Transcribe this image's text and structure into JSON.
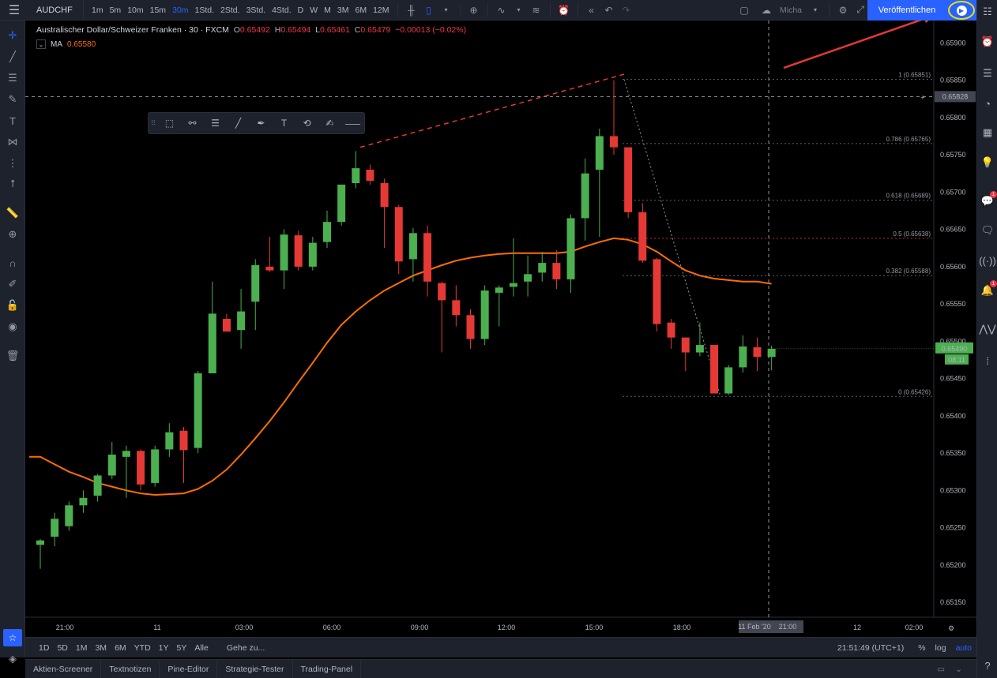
{
  "toolbar": {
    "symbol": "AUDCHF",
    "intervals": [
      "1m",
      "5m",
      "10m",
      "15m",
      "30m",
      "1Std.",
      "2Std.",
      "3Std.",
      "4Std.",
      "D",
      "W",
      "M",
      "3M",
      "6M",
      "12M"
    ],
    "active_interval": "30m",
    "layout_name": "Micha",
    "publish_label": "Veröffentlichen"
  },
  "legend": {
    "title": "Australischer Dollar/Schweizer Franken · 30 · FXCM",
    "o_key": "O",
    "o": "0.65492",
    "h_key": "H",
    "h": "0.65494",
    "l_key": "L",
    "l": "0.65461",
    "c_key": "C",
    "c": "0.65479",
    "change": "−0.00013 (−0.02%)",
    "ma_label": "MA",
    "ma_value": "0.65580"
  },
  "price_axis": {
    "ticks": [
      "0.65900",
      "0.65850",
      "0.65800",
      "0.65750",
      "0.65700",
      "0.65650",
      "0.65600",
      "0.65550",
      "0.65500",
      "0.65450",
      "0.65400",
      "0.65350",
      "0.65300",
      "0.65250",
      "0.65200",
      "0.65150"
    ],
    "crosshair_price": "0.65828",
    "last_price": "0.65490",
    "countdown": "08:11"
  },
  "time_axis": {
    "ticks": [
      "21:00",
      "11",
      "03:00",
      "06:00",
      "09:00",
      "12:00",
      "15:00",
      "18:00",
      "12",
      "02:00"
    ],
    "crosshair_time": "11 Feb '20",
    "crosshair_hour": "21:00"
  },
  "fib_levels": [
    {
      "label": "1 (0.65851)",
      "price": 0.65851
    },
    {
      "label": "0.786 (0.65765)",
      "price": 0.65765
    },
    {
      "label": "0.618 (0.65689)",
      "price": 0.65689
    },
    {
      "label": "0.5 (0.65638)",
      "price": 0.65638
    },
    {
      "label": "0.382 (0.65588)",
      "price": 0.65588
    },
    {
      "label": "0 (0.65426)",
      "price": 0.65426
    }
  ],
  "date_range": {
    "ranges": [
      "1D",
      "5D",
      "1M",
      "3M",
      "6M",
      "YTD",
      "1Y",
      "5Y",
      "Alle"
    ],
    "goto_label": "Gehe zu...",
    "clock": "21:51:49 (UTC+1)",
    "percent": "%",
    "log": "log",
    "auto": "auto"
  },
  "panels": [
    "Aktien-Screener",
    "Textnotizen",
    "Pine-Editor",
    "Strategie-Tester",
    "Trading-Panel"
  ],
  "colors": {
    "up": "#4caf50",
    "down": "#e53935",
    "ma": "#ff6d00",
    "accent": "#2962ff",
    "highlight_ring": "#e5e011",
    "arrow": "#e53935"
  },
  "chart_data": {
    "type": "candlestick",
    "title": "Australischer Dollar/Schweizer Franken · 30 · FXCM",
    "interval": "30m",
    "ylim": [
      0.6513,
      0.6593
    ],
    "candles": [
      {
        "o": 0.65227,
        "h": 0.65235,
        "l": 0.65195,
        "c": 0.65233
      },
      {
        "o": 0.65238,
        "h": 0.6527,
        "l": 0.65225,
        "c": 0.65262
      },
      {
        "o": 0.65252,
        "h": 0.65285,
        "l": 0.65246,
        "c": 0.6528
      },
      {
        "o": 0.6528,
        "h": 0.653,
        "l": 0.6527,
        "c": 0.6529
      },
      {
        "o": 0.65293,
        "h": 0.65322,
        "l": 0.65285,
        "c": 0.6532
      },
      {
        "o": 0.6532,
        "h": 0.65365,
        "l": 0.65315,
        "c": 0.65348
      },
      {
        "o": 0.65345,
        "h": 0.6536,
        "l": 0.6529,
        "c": 0.65353
      },
      {
        "o": 0.65353,
        "h": 0.65355,
        "l": 0.653,
        "c": 0.65308
      },
      {
        "o": 0.6531,
        "h": 0.6536,
        "l": 0.65305,
        "c": 0.65355
      },
      {
        "o": 0.65355,
        "h": 0.6539,
        "l": 0.65345,
        "c": 0.65378
      },
      {
        "o": 0.6538,
        "h": 0.65385,
        "l": 0.6531,
        "c": 0.65354
      },
      {
        "o": 0.65357,
        "h": 0.6546,
        "l": 0.6535,
        "c": 0.65457
      },
      {
        "o": 0.65457,
        "h": 0.6558,
        "l": 0.6551,
        "c": 0.65537
      },
      {
        "o": 0.6553,
        "h": 0.65537,
        "l": 0.65513,
        "c": 0.65513
      },
      {
        "o": 0.65515,
        "h": 0.6557,
        "l": 0.6549,
        "c": 0.6554
      },
      {
        "o": 0.65553,
        "h": 0.6561,
        "l": 0.65515,
        "c": 0.65602
      },
      {
        "o": 0.656,
        "h": 0.6564,
        "l": 0.65593,
        "c": 0.65595
      },
      {
        "o": 0.65595,
        "h": 0.6565,
        "l": 0.6557,
        "c": 0.65643
      },
      {
        "o": 0.65642,
        "h": 0.65648,
        "l": 0.65595,
        "c": 0.656
      },
      {
        "o": 0.656,
        "h": 0.6564,
        "l": 0.65595,
        "c": 0.65632
      },
      {
        "o": 0.65633,
        "h": 0.65675,
        "l": 0.65625,
        "c": 0.6566
      },
      {
        "o": 0.6566,
        "h": 0.6571,
        "l": 0.65655,
        "c": 0.6571
      },
      {
        "o": 0.65712,
        "h": 0.65755,
        "l": 0.65705,
        "c": 0.65732
      },
      {
        "o": 0.6573,
        "h": 0.65737,
        "l": 0.6571,
        "c": 0.65715
      },
      {
        "o": 0.65712,
        "h": 0.65718,
        "l": 0.65625,
        "c": 0.6568
      },
      {
        "o": 0.6568,
        "h": 0.65683,
        "l": 0.6559,
        "c": 0.65607
      },
      {
        "o": 0.6561,
        "h": 0.65652,
        "l": 0.6558,
        "c": 0.65645
      },
      {
        "o": 0.65645,
        "h": 0.65655,
        "l": 0.6556,
        "c": 0.6558
      },
      {
        "o": 0.65578,
        "h": 0.6558,
        "l": 0.65485,
        "c": 0.65555
      },
      {
        "o": 0.65555,
        "h": 0.65575,
        "l": 0.6552,
        "c": 0.65535
      },
      {
        "o": 0.65535,
        "h": 0.65543,
        "l": 0.6549,
        "c": 0.65503
      },
      {
        "o": 0.65503,
        "h": 0.65575,
        "l": 0.65495,
        "c": 0.65568
      },
      {
        "o": 0.65565,
        "h": 0.65575,
        "l": 0.6552,
        "c": 0.65572
      },
      {
        "o": 0.65573,
        "h": 0.65638,
        "l": 0.6556,
        "c": 0.65578
      },
      {
        "o": 0.6558,
        "h": 0.65615,
        "l": 0.6556,
        "c": 0.6559
      },
      {
        "o": 0.65592,
        "h": 0.6562,
        "l": 0.6558,
        "c": 0.65605
      },
      {
        "o": 0.65605,
        "h": 0.65622,
        "l": 0.6557,
        "c": 0.65583
      },
      {
        "o": 0.65583,
        "h": 0.6567,
        "l": 0.65565,
        "c": 0.65665
      },
      {
        "o": 0.65665,
        "h": 0.65745,
        "l": 0.65635,
        "c": 0.65725
      },
      {
        "o": 0.6573,
        "h": 0.65785,
        "l": 0.6564,
        "c": 0.65775
      },
      {
        "o": 0.65775,
        "h": 0.6585,
        "l": 0.6575,
        "c": 0.6576
      },
      {
        "o": 0.6576,
        "h": 0.6576,
        "l": 0.65665,
        "c": 0.65673
      },
      {
        "o": 0.65673,
        "h": 0.65685,
        "l": 0.65605,
        "c": 0.65608
      },
      {
        "o": 0.6561,
        "h": 0.65612,
        "l": 0.65513,
        "c": 0.65523
      },
      {
        "o": 0.65525,
        "h": 0.6553,
        "l": 0.6549,
        "c": 0.65505
      },
      {
        "o": 0.65505,
        "h": 0.65505,
        "l": 0.6546,
        "c": 0.65485
      },
      {
        "o": 0.65485,
        "h": 0.65525,
        "l": 0.6548,
        "c": 0.65495
      },
      {
        "o": 0.65495,
        "h": 0.65495,
        "l": 0.6543,
        "c": 0.6543
      },
      {
        "o": 0.6543,
        "h": 0.65468,
        "l": 0.65428,
        "c": 0.65465
      },
      {
        "o": 0.65465,
        "h": 0.65508,
        "l": 0.65458,
        "c": 0.65493
      },
      {
        "o": 0.65492,
        "h": 0.65505,
        "l": 0.6546,
        "c": 0.65479
      },
      {
        "o": 0.65479,
        "h": 0.65494,
        "l": 0.65461,
        "c": 0.6549
      }
    ],
    "ma": [
      0.65345,
      0.65335,
      0.65325,
      0.65318,
      0.6531,
      0.65305,
      0.653,
      0.65296,
      0.65294,
      0.65295,
      0.65296,
      0.65302,
      0.65313,
      0.65328,
      0.65348,
      0.6537,
      0.65393,
      0.65418,
      0.65445,
      0.65471,
      0.65498,
      0.65522,
      0.6554,
      0.65555,
      0.65568,
      0.65578,
      0.65588,
      0.65595,
      0.65602,
      0.65608,
      0.65612,
      0.65615,
      0.65617,
      0.65618,
      0.65618,
      0.65618,
      0.65618,
      0.6562,
      0.65627,
      0.65633,
      0.65638,
      0.65636,
      0.6563,
      0.6562,
      0.65607,
      0.65595,
      0.65588,
      0.65584,
      0.65582,
      0.6558,
      0.6558,
      0.65577
    ]
  }
}
